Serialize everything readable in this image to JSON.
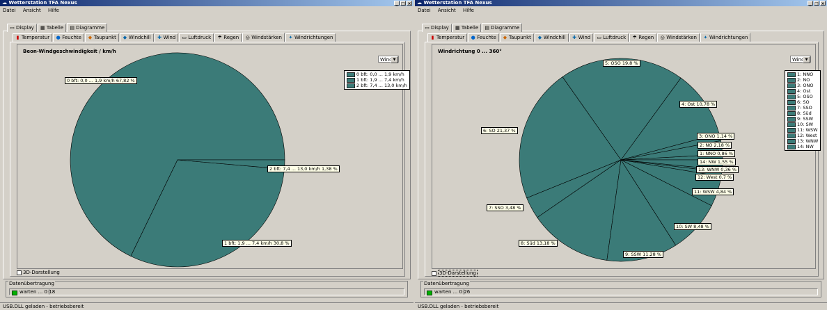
{
  "colors": {
    "pie": "#3b7b78",
    "titlebar": "#0a246a",
    "led": "#00b000"
  },
  "windows": [
    {
      "title": "Wetterstation TFA Nexus",
      "menu": [
        "Datei",
        "Ansicht",
        "Hilfe"
      ],
      "view_tabs": [
        "Display",
        "Tabelle",
        "Diagramme"
      ],
      "chart_tabs": [
        "Temperatur",
        "Feuchte",
        "Taupunkt",
        "Windchill",
        "Wind",
        "Luftdruck",
        "Regen",
        "Windstärken",
        "Windrichtungen"
      ],
      "active_chart_tab": "Windstärken",
      "chart_title": "Beon-Windgeschwindigkeit / km/h",
      "select_value": "Wind",
      "checkbox_label": "3D-Darstellung",
      "group_label": "Datenübertragung",
      "status_wait": "warten ... 0:18",
      "statusbar": "USB.DLL geladen - betriebsbereit",
      "legend": [
        "0 bft: 0,0 ... 1,9 km/h",
        "1 bft: 1,9 ... 7,4 km/h",
        "2 bft: 7,4 ... 13,0 km/h"
      ],
      "slice_labels": [
        "0 bft: 0,0 ... 1,9 km/h 67,82 %",
        "1 bft: 1,9 ... 7,4 km/h 30,8 %",
        "2 bft: 7,4 ... 13,0 km/h 1,38 %"
      ]
    },
    {
      "title": "Wetterstation TFA Nexus",
      "menu": [
        "Datei",
        "Ansicht",
        "Hilfe"
      ],
      "view_tabs": [
        "Display",
        "Tabelle",
        "Diagramme"
      ],
      "chart_tabs": [
        "Temperatur",
        "Feuchte",
        "Taupunkt",
        "Windchill",
        "Wind",
        "Luftdruck",
        "Regen",
        "Windstärken",
        "Windrichtungen"
      ],
      "active_chart_tab": "Windrichtungen",
      "chart_title": "Windrichtung 0 ... 360°",
      "select_value": "Wind",
      "checkbox_label": "3D-Darstellung",
      "group_label": "Datenübertragung",
      "status_wait": "warten ... 0:26",
      "statusbar": "USB.DLL geladen - betriebsbereit",
      "legend": [
        "1: NNO",
        "2: NO",
        "3: ONO",
        "4: Ost",
        "5: OSO",
        "6: SO",
        "7: SSO",
        "8: Süd",
        "9: SSW",
        "10: SW",
        "11: WSW",
        "12: West",
        "13: WNW",
        "14: NW"
      ],
      "slice_labels": [
        "1: NNO 0,86 %",
        "2: NO 2,18 %",
        "3: ONO 1,14 %",
        "4: Ost 10,78 %",
        "5: OSO 19,8 %",
        "6: SO 21,37 %",
        "7: SSO 3,48 %",
        "8: Süd 13,18 %",
        "9: SSW 11,28 %",
        "10: SW 8,48 %",
        "11: WSW 4,84 %",
        "12: West 0,7 %",
        "13: WNW 0,36 %",
        "14: NW 1,55 %"
      ]
    }
  ],
  "chart_data": [
    {
      "type": "pie",
      "title": "Beon-Windgeschwindigkeit / km/h",
      "categories": [
        "0 bft: 0,0 ... 1,9 km/h",
        "1 bft: 1,9 ... 7,4 km/h",
        "2 bft: 7,4 ... 13,0 km/h"
      ],
      "values": [
        67.82,
        30.8,
        1.38
      ]
    },
    {
      "type": "pie",
      "title": "Windrichtung 0 ... 360°",
      "categories": [
        "1: NNO",
        "2: NO",
        "3: ONO",
        "4: Ost",
        "5: OSO",
        "6: SO",
        "7: SSO",
        "8: Süd",
        "9: SSW",
        "10: SW",
        "11: WSW",
        "12: West",
        "13: WNW",
        "14: NW"
      ],
      "values": [
        0.86,
        2.18,
        1.14,
        10.78,
        19.8,
        21.37,
        3.48,
        13.18,
        11.28,
        8.48,
        4.84,
        0.7,
        0.36,
        1.55
      ]
    }
  ]
}
